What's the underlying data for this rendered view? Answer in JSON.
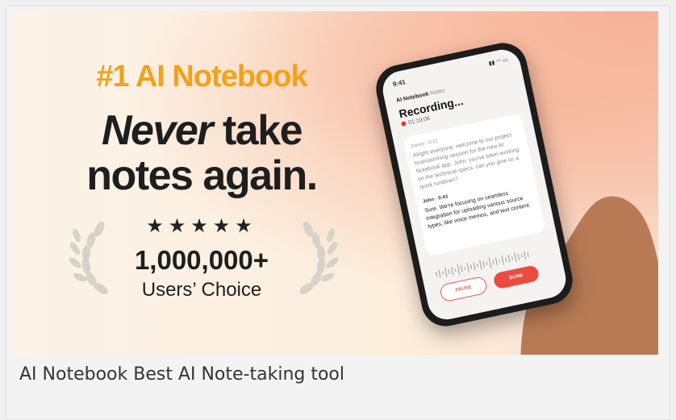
{
  "banner": {
    "tagline": "#1 AI Notebook",
    "headline_em": "Never",
    "headline_rest": " take",
    "headline_line2": "notes again.",
    "stars": "★★★★★",
    "users_count": "1,000,000+",
    "users_label": "Users’ Choice"
  },
  "phone": {
    "time": "9:41",
    "status_icons": "▮▮ ◠ ▭",
    "nav_app": "AI Notebook",
    "nav_section": "Notes",
    "title": "Recording...",
    "elapsed": "01:19:06",
    "transcript": [
      {
        "speaker": "Daniel",
        "time": "0:12",
        "text": "Alright everyone, welcome to our project brainstorming session for the new AI Notebook app. John, you've been working on the technical specs, can you give us a quick rundown?"
      },
      {
        "speaker": "John",
        "time": "0:43",
        "text": "Sure. We're focusing on seamless integration for uploading various source types, like voice memos, and text content."
      }
    ],
    "pause_label": "PAUSE",
    "done_label": "DONE"
  },
  "caption": "AI Notebook Best AI Note-taking tool",
  "colors": {
    "accent_orange": "#f0a21a",
    "record_red": "#e53935",
    "done_button": "#ea4c3f"
  }
}
